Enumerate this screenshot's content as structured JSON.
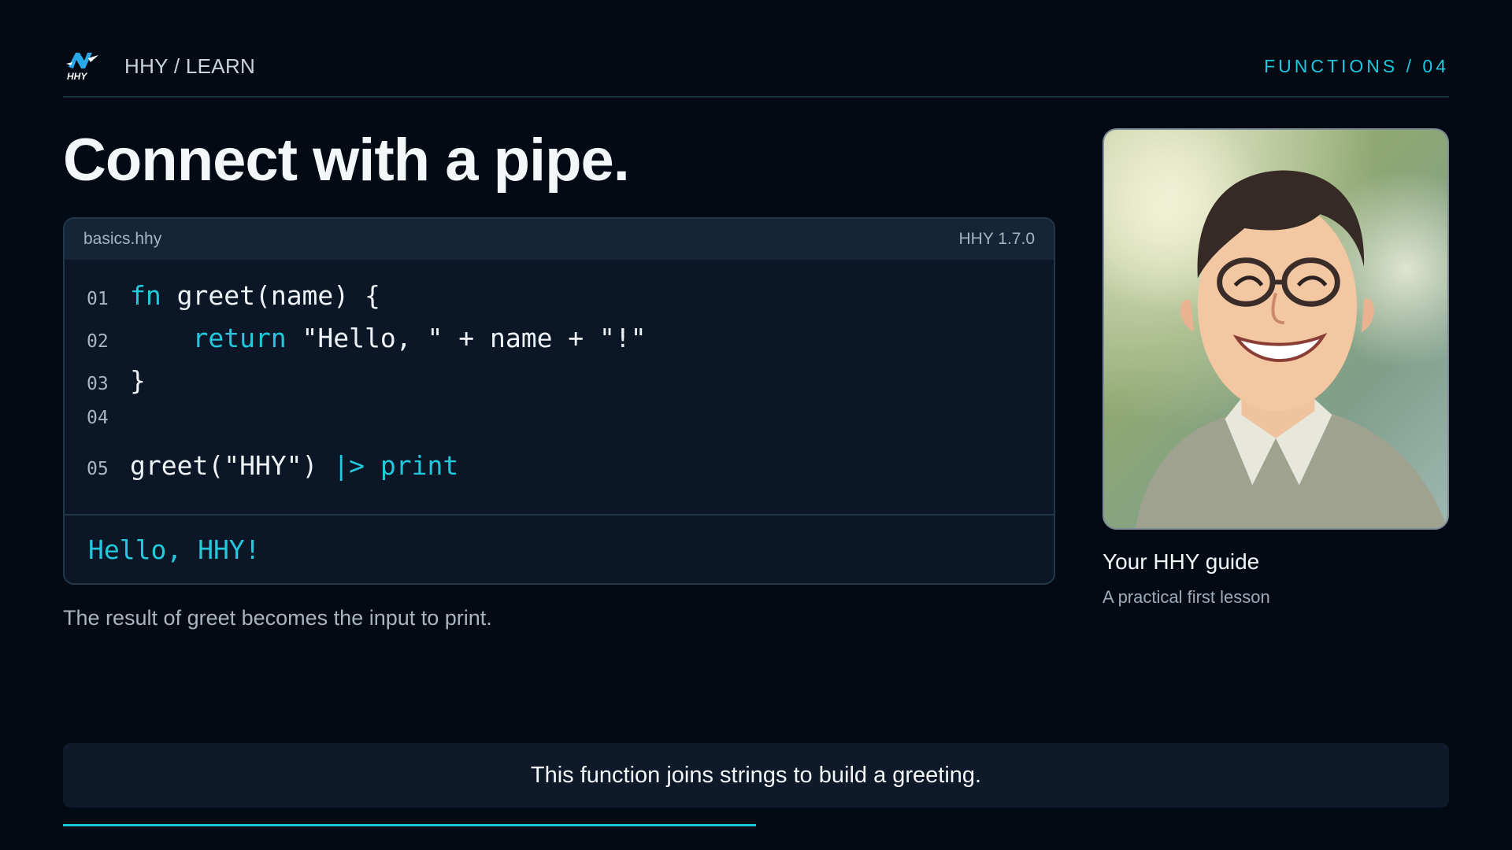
{
  "header": {
    "brand": "HHY / LEARN",
    "section": "FUNCTIONS / 04",
    "logo_text": "HHY"
  },
  "slide": {
    "title": "Connect with a pipe.",
    "caption": "The result of greet becomes the input to print.",
    "note": "This function joins strings to build a greeting."
  },
  "code": {
    "filename": "basics.hhy",
    "version": "HHY 1.7.0",
    "lines": [
      {
        "num": "01",
        "kw1": "fn",
        "text": " greet(name) {",
        "kw2": ""
      },
      {
        "num": "02",
        "kw1": "    return",
        "text": " \"Hello, \" + name + \"!\"",
        "kw2": ""
      },
      {
        "num": "03",
        "kw1": "",
        "text": "}",
        "kw2": ""
      },
      {
        "num": "04",
        "kw1": "",
        "text": "",
        "kw2": ""
      },
      {
        "num": "05",
        "kw1": "",
        "text": "greet(\"HHY\") ",
        "kw2": "|> print"
      }
    ],
    "output": "Hello, HHY!"
  },
  "guide": {
    "title": "Your HHY guide",
    "subtitle": "A practical first lesson"
  },
  "progress": {
    "fraction": 0.5
  },
  "colors": {
    "background": "#040a14",
    "accent": "#1fc7dc",
    "panel": "#0b1726"
  }
}
